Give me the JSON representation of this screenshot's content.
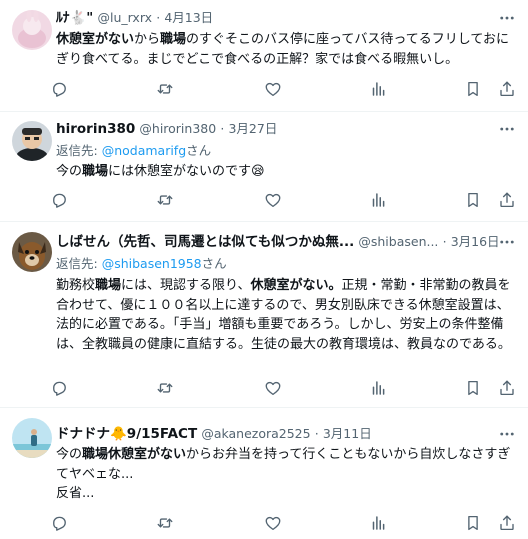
{
  "colors": {
    "link": "#1d9bf0",
    "secondary": "#536471",
    "text": "#0f1419",
    "divider": "#eff3f4"
  },
  "icons": {
    "reply": "reply-icon",
    "retweet": "retweet-icon",
    "like": "heart-icon",
    "views": "analytics-icon",
    "bookmark": "bookmark-icon",
    "share": "share-icon",
    "more": "more-icon"
  },
  "tweets": [
    {
      "name": "ﾙﾅ🐇\"",
      "handle": "@lu_rxrx",
      "date": "4月13日",
      "segments": [
        {
          "t": "休憩室がない",
          "b": true
        },
        {
          "t": "から",
          "b": false
        },
        {
          "t": "職場",
          "b": true
        },
        {
          "t": "のすぐそこのバス停に座ってバス待ってるフリしておにぎり食べてる。まじでどこで食べるの正解？家では食べる暇無いし。",
          "b": false
        }
      ]
    },
    {
      "name": "hirorin380",
      "handle": "@hirorin380",
      "date": "3月27日",
      "reply_prefix": "返信先: ",
      "reply_to": "@nodamarifg",
      "reply_suffix": "さん",
      "segments": [
        {
          "t": "今の",
          "b": false
        },
        {
          "t": "職場",
          "b": true
        },
        {
          "t": "には休憩室がないのです😪",
          "b": false
        }
      ]
    },
    {
      "name": "しばせん（先哲、司馬遷とは似ても似つかぬ無...",
      "handle": "@shibasen...",
      "date": "3月16日",
      "reply_prefix": "返信先: ",
      "reply_to": "@shibasen1958",
      "reply_suffix": "さん",
      "segments": [
        {
          "t": "勤務校",
          "b": false
        },
        {
          "t": "職場",
          "b": true
        },
        {
          "t": "には、現認する限り、",
          "b": false
        },
        {
          "t": "休憩室がない。",
          "b": true
        },
        {
          "t": "正規・常勤・非常勤の教員を合わせて、優に１００名以上に達するので、男女別臥床できる休憩室設置は、法的に必置である。「手当」増額も重要であろう。しかし、労安上の条件整備は、全教職員の健康に直結する。生徒の最大の教育環境は、教員なのである。",
          "b": false
        }
      ]
    },
    {
      "name": "ドナドナ🐥9/15FACT",
      "handle": "@akanezora2525",
      "date": "3月11日",
      "segments": [
        {
          "t": "今の",
          "b": false
        },
        {
          "t": "職場休憩室がない",
          "b": true
        },
        {
          "t": "からお弁当を持って行くこともないから自炊しなさすぎてヤベェな...\n反省...",
          "b": false
        }
      ]
    }
  ]
}
